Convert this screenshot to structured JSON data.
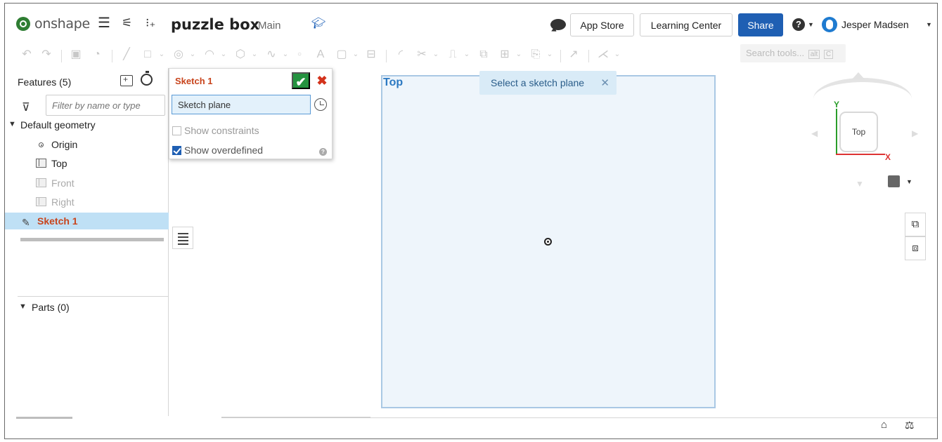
{
  "app": {
    "logo_text": "onshape",
    "doc_title": "puzzle box",
    "branch": "Main"
  },
  "header": {
    "app_store": "App Store",
    "learning_center": "Learning Center",
    "share": "Share",
    "help": "?",
    "user": "Jesper Madsen"
  },
  "toolbar": {
    "search_placeholder": "Search tools...",
    "search_shortcut_1": "alt",
    "search_shortcut_2": "C"
  },
  "features": {
    "title": "Features (5)",
    "filter_placeholder": "Filter by name or type",
    "default_geometry": "Default geometry",
    "items": [
      {
        "label": "Origin"
      },
      {
        "label": "Top"
      },
      {
        "label": "Front"
      },
      {
        "label": "Right"
      },
      {
        "label": "Sketch 1"
      }
    ],
    "parts": "Parts (0)"
  },
  "sketch_dialog": {
    "title": "Sketch 1",
    "plane_field": "Sketch plane",
    "show_constraints": "Show constraints",
    "show_overdefined": "Show overdefined",
    "show_constraints_checked": false,
    "show_overdefined_checked": true
  },
  "viewport": {
    "plane_label": "Top",
    "toast": "Select a sketch plane",
    "cube_face": "Top",
    "axis_x": "X",
    "axis_y": "Y"
  },
  "colors": {
    "brand_blue": "#1f5fb3",
    "accent_orange": "#c8441c",
    "ok_green": "#259340",
    "cancel_red": "#d3331c"
  }
}
